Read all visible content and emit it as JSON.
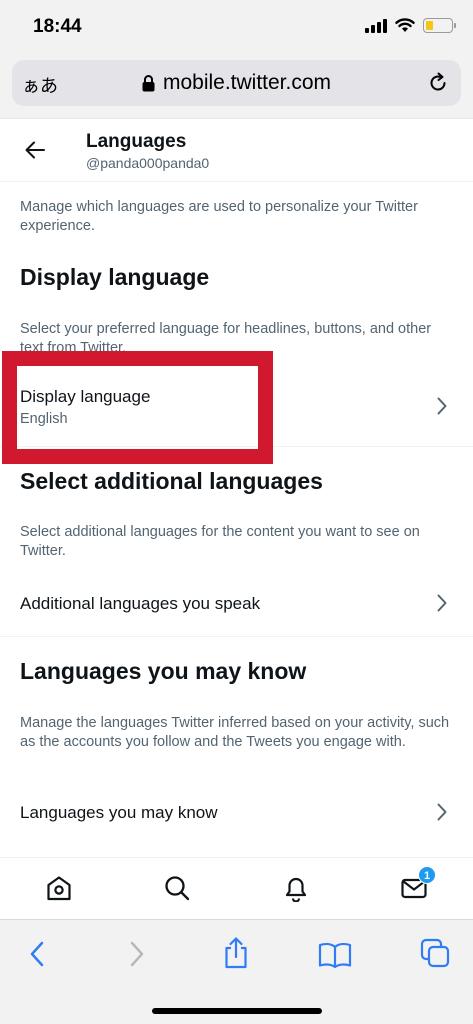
{
  "status_bar": {
    "time": "18:44"
  },
  "browser": {
    "text_size_button": "ぁあ",
    "url": "mobile.twitter.com"
  },
  "header": {
    "title": "Languages",
    "username": "@panda000panda0"
  },
  "intro": "Manage which languages are used to personalize your Twitter experience.",
  "display_language_section": {
    "title": "Display language",
    "description": "Select your preferred language for headlines, buttons, and other text from Twitter.",
    "row_label": "Display language",
    "row_value": "English"
  },
  "additional_section": {
    "title": "Select additional languages",
    "description": "Select additional languages for the content you want to see on Twitter.",
    "row_label": "Additional languages you speak"
  },
  "may_know_section": {
    "title": "Languages you may know",
    "description": "Manage the languages Twitter inferred based on your activity, such as the accounts you follow and the Tweets you engage with.",
    "row_label": "Languages you may know"
  },
  "bottom_nav": {
    "messages_badge": "1"
  },
  "colors": {
    "highlight": "#d0182e",
    "accent": "#1d9bf0",
    "safari_blue": "#2f7cf6"
  }
}
